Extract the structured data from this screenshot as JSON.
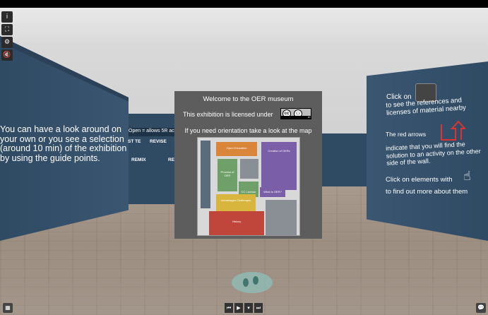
{
  "left_wall": {
    "text": "You can have a look around on your own or you see a selection (around 10 min) of the exhibition by using the guide points."
  },
  "middle_wall": {
    "caption": "Open = allows 5R act",
    "labels": [
      "ST TE",
      "REVISE",
      "REMIX",
      "RE"
    ]
  },
  "right_wall": {
    "click_on": "Click on",
    "references_text": "to see the references and licenses of material nearby",
    "red_arrows": "The red arrows",
    "arrows_text": "indicate that you will find the solution to an activity on the other side of the wall.",
    "click_elements": "Click on elements with",
    "find_more": "to find out more about them"
  },
  "dialog": {
    "title": "Welcome to the OER museum",
    "license_text": "This exhibition is licensed under",
    "license_badge": [
      "cc",
      "BY"
    ],
    "orientation_text": "If you need orientation take a look at the map"
  },
  "map": {
    "zones": [
      "Open Education",
      "Creation of OERs",
      "Process of OER",
      "What Is OER?",
      "CC License",
      "Advantages Challenges",
      "History"
    ],
    "colors": {
      "orange": "#d9853a",
      "purple": "#7b5ea8",
      "green": "#6fa06a",
      "yellow": "#d8b63e",
      "red": "#c0453a",
      "gray": "#8a8f96"
    }
  },
  "controls": {
    "left_buttons": [
      "i",
      "⛶",
      "⚙",
      "🔇"
    ],
    "bottom_buttons": [
      "⏮",
      "▶",
      "▾",
      "⏭"
    ]
  },
  "icons": {
    "info": "info-icon",
    "fullscreen": "fullscreen-icon",
    "settings": "gear-icon",
    "mute": "mute-icon"
  }
}
